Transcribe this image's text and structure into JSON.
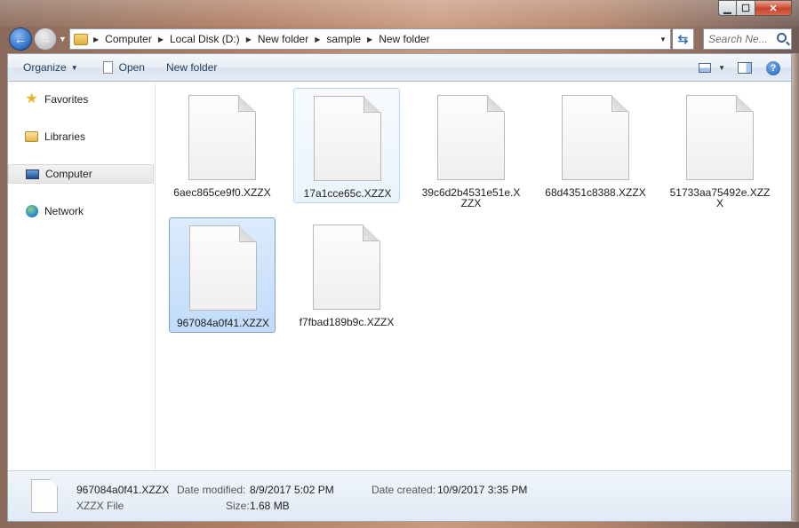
{
  "window": {
    "min_glyph": "▁",
    "max_glyph": "☐",
    "close_glyph": "✕"
  },
  "address": {
    "crumbs": [
      "Computer",
      "Local Disk (D:)",
      "New folder",
      "sample",
      "New folder"
    ],
    "search_placeholder": "Search Ne..."
  },
  "toolbar": {
    "organize_label": "Organize",
    "open_label": "Open",
    "new_folder_label": "New folder"
  },
  "nav": {
    "items": [
      {
        "label": "Favorites",
        "icon": "star-icon"
      },
      {
        "label": "Libraries",
        "icon": "libraries-icon"
      },
      {
        "label": "Computer",
        "icon": "computer-icon"
      },
      {
        "label": "Network",
        "icon": "network-icon"
      }
    ]
  },
  "files": [
    {
      "name": "6aec865ce9f0.XZZX"
    },
    {
      "name": "17a1cce65c.XZZX"
    },
    {
      "name": "39c6d2b4531e51e.XZZX"
    },
    {
      "name": "68d4351c8388.XZZX"
    },
    {
      "name": "51733aa75492e.XZZX"
    },
    {
      "name": "967084a0f41.XZZX"
    },
    {
      "name": "f7fbad189b9c.XZZX"
    }
  ],
  "details": {
    "name": "967084a0f41.XZZX",
    "type": "XZZX File",
    "date_modified_label": "Date modified:",
    "date_modified": "8/9/2017 5:02 PM",
    "size_label": "Size:",
    "size": "1.68 MB",
    "date_created_label": "Date created:",
    "date_created": "10/9/2017 3:35 PM"
  },
  "colors": {
    "selection": "#c1dcfa",
    "toolbar_text": "#1e3d5e"
  }
}
